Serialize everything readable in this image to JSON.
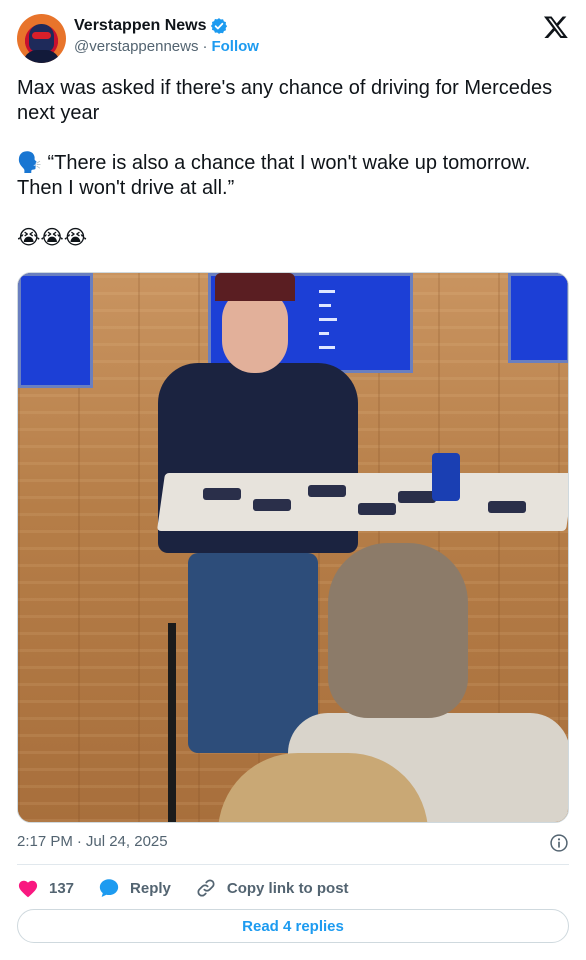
{
  "author": {
    "display_name": "Verstappen News",
    "handle": "@verstappennews",
    "separator": "·",
    "follow_label": "Follow"
  },
  "tweet": {
    "text": "Max was asked if there's any chance of driving for Mercedes next year\n\n🗣️ “There is also a chance that I won't wake up tomorrow. Then I won't drive at all.”\n\n😭😭😭"
  },
  "meta": {
    "time": "2:17 PM",
    "separator": "·",
    "date": "Jul 24, 2025"
  },
  "actions": {
    "like_count": "137",
    "reply_label": "Reply",
    "copy_link_label": "Copy link to post"
  },
  "footer": {
    "read_replies_label": "Read 4 replies"
  },
  "colors": {
    "accent": "#1d9bf0",
    "like": "#f91880",
    "secondary_text": "#536471"
  },
  "icons": [
    "verified-badge-icon",
    "x-logo-icon",
    "info-icon",
    "heart-icon",
    "reply-bubble-icon",
    "link-icon"
  ]
}
